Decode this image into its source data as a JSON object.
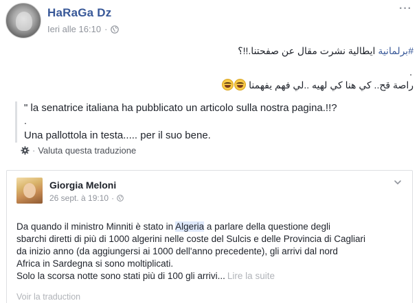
{
  "post": {
    "author": "HaRaGa Dz",
    "timestamp": "Ieri alle 16:10",
    "separator": "·",
    "privacy_icon": "globe-icon",
    "more_icon": "more-options-icon",
    "more_glyph": "···"
  },
  "arabic": {
    "line1_hashtag": "#برلمانية",
    "line1_rest": " ايطالية نشرت مقال عن صفحتنا.!!؟",
    "line2_dot": ".",
    "line3_text": "راصة قح.. كي هنا كي لهيه ..لي فهم يفهمنا"
  },
  "translation": {
    "line1": "\" la senatrice italiana ha pubblicato un articolo sulla nostra pagina.!!?",
    "line2": ".",
    "line3": "Una pallottola in testa..... per il suo bene.",
    "rate_label": "Valuta questa traduzione",
    "rate_separator": "·"
  },
  "shared": {
    "author": "Giorgia Meloni",
    "timestamp": "26 sept. à 19:10",
    "separator": "·",
    "text_before_highlight": "Da quando il ministro Minniti è stato in ",
    "highlight": "Algeria",
    "text_after_highlight": " a parlare della questione degli",
    "line2": "sbarchi diretti di più di 1000 algerini nelle coste del Sulcis e delle Provincia di Cagliari",
    "line3": "da inizio anno (da aggiungersi ai 1000 dell'anno precedente), gli arrivi dal nord",
    "line4": "Africa in Sardegna si sono moltiplicati.",
    "line5": "Solo la scorsa notte sono stati più di 100 gli arrivi...",
    "see_more": "Lire la suite",
    "see_translation": "Voir la traduction"
  }
}
